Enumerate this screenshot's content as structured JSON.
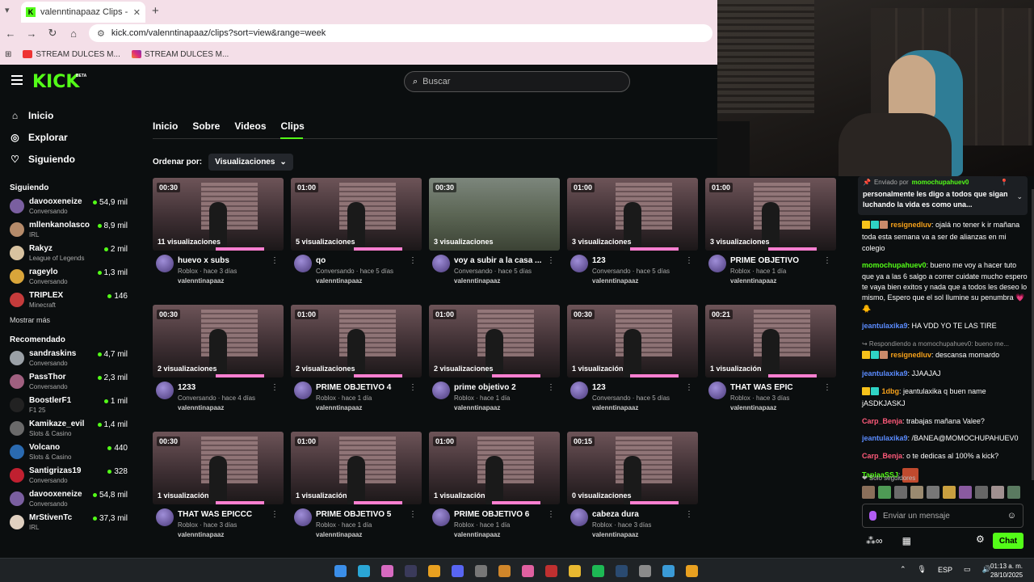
{
  "browser": {
    "tab_title": "valenntinapaaz Clips - Watch Liv",
    "url": "kick.com/valenntinapaaz/clips?sort=view&range=week",
    "bookmarks": [
      "STREAM DULCES M...",
      "STREAM DULCES M..."
    ]
  },
  "header": {
    "logo": "KICK",
    "beta": "BETA",
    "search_placeholder": "Buscar"
  },
  "sidebar": {
    "nav": [
      "Inicio",
      "Explorar",
      "Siguiendo"
    ],
    "following_title": "Siguiendo",
    "following": [
      {
        "name": "davooxeneize",
        "cat": "Conversando",
        "viewers": "54,9 mil",
        "color": "#7a5fa0"
      },
      {
        "name": "mllenkanolasco",
        "cat": "IRL",
        "viewers": "8,9 mil",
        "color": "#b58b6a"
      },
      {
        "name": "Rakyz",
        "cat": "League of Legends",
        "viewers": "2 mil",
        "color": "#d8c2a0"
      },
      {
        "name": "rageylo",
        "cat": "Conversando",
        "viewers": "1,3 mil",
        "color": "#d9a53a"
      },
      {
        "name": "TRIPLEX",
        "cat": "Minecraft",
        "viewers": "146",
        "color": "#c43b3b"
      }
    ],
    "show_more": "Mostrar más",
    "recommended_title": "Recomendado",
    "recommended": [
      {
        "name": "sandraskins",
        "cat": "Conversando",
        "viewers": "4,7 mil",
        "color": "#9aa0a6"
      },
      {
        "name": "PassThor",
        "cat": "Conversando",
        "viewers": "2,3 mil",
        "color": "#a06080"
      },
      {
        "name": "BoostlerF1",
        "cat": "F1 25",
        "viewers": "1 mil",
        "color": "#222222"
      },
      {
        "name": "Kamikaze_evil",
        "cat": "Slots & Casino",
        "viewers": "1,4 mil",
        "color": "#6a6a6a"
      },
      {
        "name": "Volcano",
        "cat": "Slots & Casino",
        "viewers": "440",
        "color": "#2a6ab0"
      },
      {
        "name": "Santigrizas19",
        "cat": "Conversando",
        "viewers": "328",
        "color": "#c02030"
      },
      {
        "name": "davooxeneize",
        "cat": "Conversando",
        "viewers": "54,8 mil",
        "color": "#7a5fa0"
      },
      {
        "name": "MrStivenTc",
        "cat": "IRL",
        "viewers": "37,3 mil",
        "color": "#e0d0c0"
      }
    ]
  },
  "main": {
    "tabs": [
      "Inicio",
      "Sobre",
      "Videos",
      "Clips"
    ],
    "active_tab": "Clips",
    "sort_label": "Ordenar por:",
    "sort_value": "Visualizaciones",
    "clips": [
      {
        "dur": "00:30",
        "views": "11 visualizaciones",
        "title": "huevo x subs",
        "meta": "Roblox · hace 3 días",
        "channel": "valenntinapaaz"
      },
      {
        "dur": "01:00",
        "views": "5 visualizaciones",
        "title": "qo",
        "meta": "Conversando · hace 5 días",
        "channel": "valenntinapaaz"
      },
      {
        "dur": "00:30",
        "views": "3 visualizaciones",
        "title": "voy a subir a la casa ...",
        "meta": "Conversando · hace 5 días",
        "channel": "valenntinapaaz"
      },
      {
        "dur": "01:00",
        "views": "3 visualizaciones",
        "title": "123",
        "meta": "Conversando · hace 5 días",
        "channel": "valenntinapaaz"
      },
      {
        "dur": "01:00",
        "views": "3 visualizaciones",
        "title": "PRIME OBJETIVO",
        "meta": "Roblox · hace 1 día",
        "channel": "valenntinapaaz"
      },
      {
        "dur": "00:30",
        "views": "2 visualizaciones",
        "title": "1233",
        "meta": "Conversando · hace 4 días",
        "channel": "valenntinapaaz"
      },
      {
        "dur": "01:00",
        "views": "2 visualizaciones",
        "title": "PRIME OBJETIVO 4",
        "meta": "Roblox · hace 1 día",
        "channel": "valenntinapaaz"
      },
      {
        "dur": "01:00",
        "views": "2 visualizaciones",
        "title": "prime objetivo 2",
        "meta": "Roblox · hace 1 día",
        "channel": "valenntinapaaz"
      },
      {
        "dur": "00:30",
        "views": "1 visualización",
        "title": "123",
        "meta": "Conversando · hace 5 días",
        "channel": "valenntinapaaz"
      },
      {
        "dur": "00:21",
        "views": "1 visualización",
        "title": "THAT WAS EPIC",
        "meta": "Roblox · hace 3 días",
        "channel": "valenntinapaaz"
      },
      {
        "dur": "00:30",
        "views": "1 visualización",
        "title": "THAT WAS EPICCC",
        "meta": "Roblox · hace 3 días",
        "channel": "valenntinapaaz"
      },
      {
        "dur": "01:00",
        "views": "1 visualización",
        "title": "PRIME OBJETIVO 5",
        "meta": "Roblox · hace 1 día",
        "channel": "valenntinapaaz"
      },
      {
        "dur": "01:00",
        "views": "1 visualización",
        "title": "PRIME OBJETIVO 6",
        "meta": "Roblox · hace 1 día",
        "channel": "valenntinapaaz"
      },
      {
        "dur": "00:15",
        "views": "0 visualizaciones",
        "title": "cabeza dura",
        "meta": "Roblox · hace 3 días",
        "channel": "valenntinapaaz"
      }
    ]
  },
  "chat": {
    "pinned_by_label": "Enviado por",
    "pinned_by": "momochupahuev0",
    "pinned_msg": "personalmente les digo a todos que sigan luchando la vida es como una...",
    "messages": [
      {
        "user": "resignedluv",
        "color": "#f7a21b",
        "badges": 3,
        "text": ": ojalá no tener k ir mañana toda esta semana va a ser de alianzas en mi colegio"
      },
      {
        "user": "momochupahuev0",
        "color": "#53fc18",
        "badges": 0,
        "text": ": bueno me voy a hacer tuto que ya a las 6 salgo a correr cuidate mucho espero te vaya bien exitos y nada que a todos les deseo lo mismo, Espero que el sol Ilumine su penumbra 💗 🐥"
      },
      {
        "user": "jeantulaxika9",
        "color": "#5b8cff",
        "badges": 0,
        "text": ": HA VDD YO TE LAS TIRE"
      },
      {
        "reply": "↪ Respondiendo a momochupahuev0: bueno me...",
        "user": "resignedluv",
        "color": "#f7a21b",
        "badges": 3,
        "text": ": descansa momardo"
      },
      {
        "user": "jeantulaxika9",
        "color": "#5b8cff",
        "badges": 0,
        "text": ": JJAAJAJ"
      },
      {
        "user": "1dbg",
        "color": "#f7a21b",
        "badges": 2,
        "text": ": jeantulaxika q buen name jASDKJASKJ"
      },
      {
        "user": "Carp_Benja",
        "color": "#ff5a7a",
        "badges": 0,
        "text": ": trabajas mañana Valee?"
      },
      {
        "user": "jeantulaxika9",
        "color": "#5b8cff",
        "badges": 0,
        "text": ": /BANEA@MOMOCHUPAHUEV0"
      },
      {
        "user": "Carp_Benja",
        "color": "#ff5a7a",
        "badges": 0,
        "text": ": o te dedicas al 100% a kick?"
      },
      {
        "user": "TapiaaSSJ",
        "color": "#53fc18",
        "badges": 0,
        "text": ":",
        "emote": true
      }
    ],
    "followers_only": "❤ Solo seguidores",
    "input_placeholder": "Enviar un mensaje",
    "send_label": "Chat"
  },
  "taskbar": {
    "lang": "ESP",
    "time": "01:13 a. m.",
    "date": "28/10/2025"
  }
}
